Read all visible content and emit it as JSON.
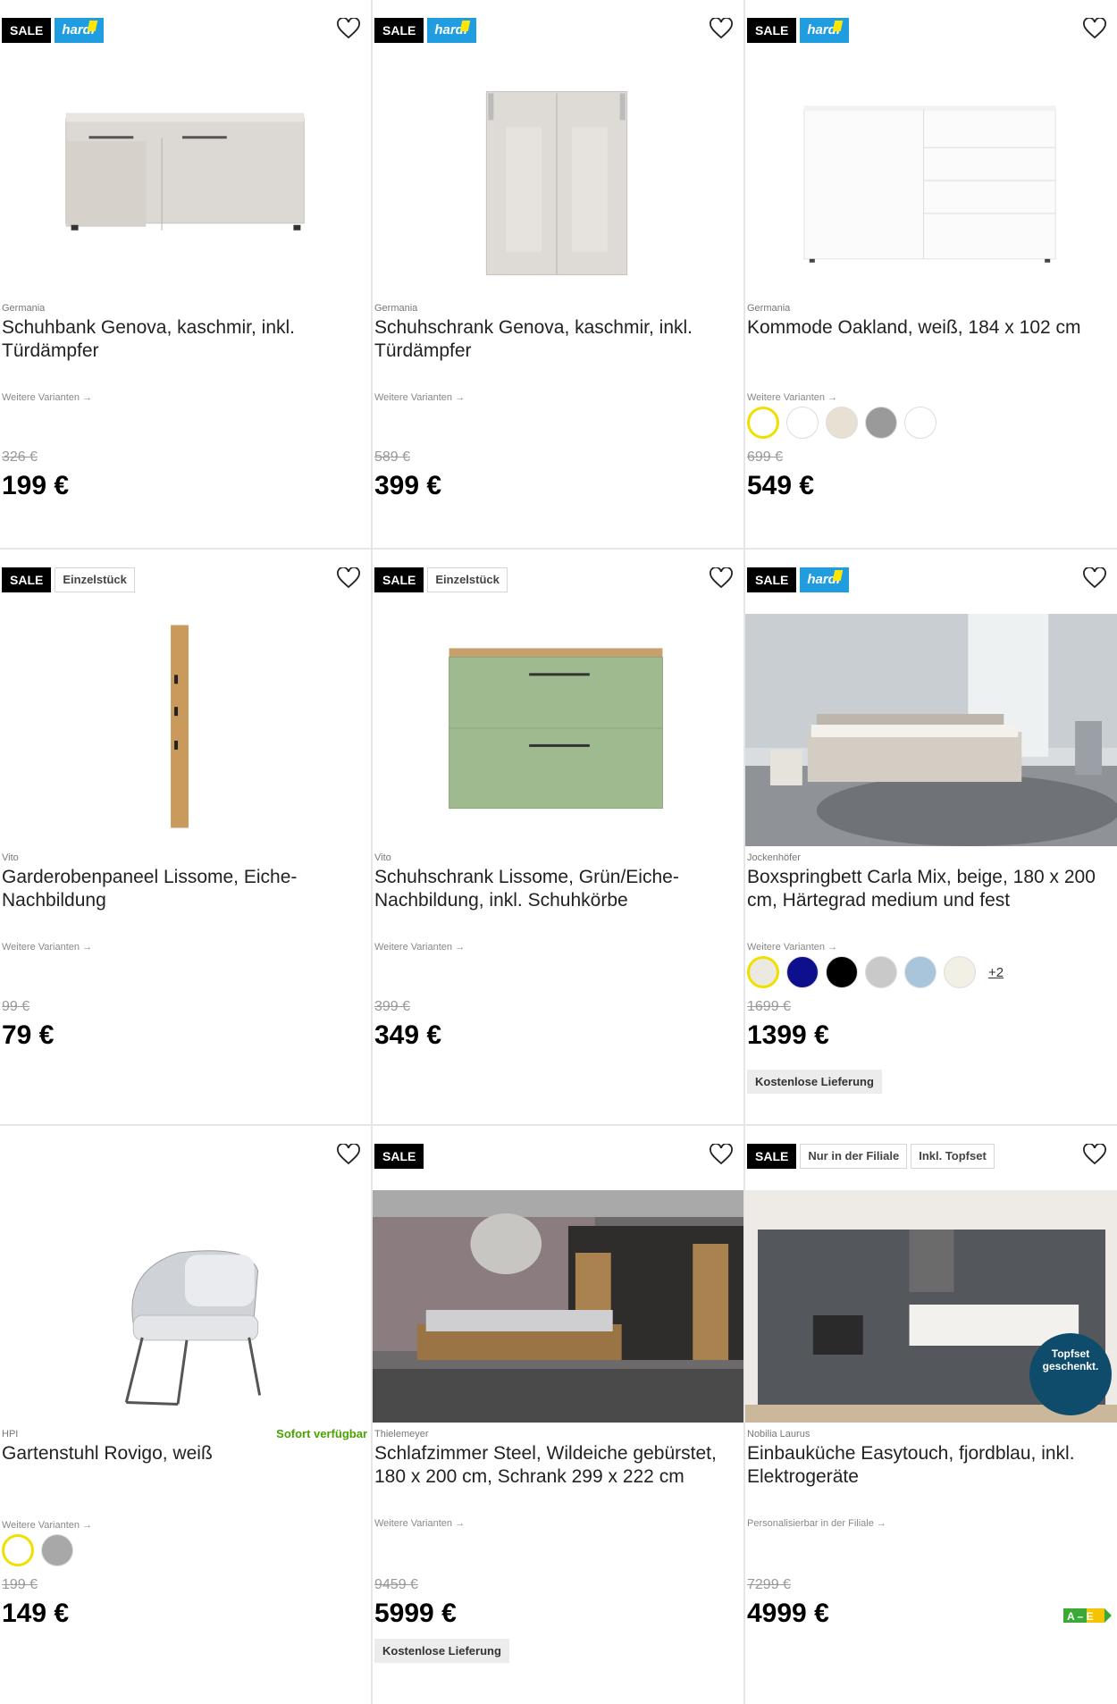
{
  "common": {
    "sale": "SALE",
    "hardi": "hardi",
    "variants_link": "Weitere Varianten →",
    "delivery": "Kostenlose Lieferung"
  },
  "products": [
    {
      "brand": "Germania",
      "title": "Schuhbank Genova, kaschmir, inkl. Türdämpfer",
      "old_price": "326 €",
      "price": "199 €",
      "tags": [],
      "variants": "Weitere Varianten →"
    },
    {
      "brand": "Germania",
      "title": "Schuhschrank Genova, kaschmir, inkl. Türdämpfer",
      "old_price": "589 €",
      "price": "399 €",
      "tags": [],
      "variants": "Weitere Varianten →"
    },
    {
      "brand": "Germania",
      "title": "Kommode Oakland, weiß, 184 x 102 cm",
      "old_price": "699 €",
      "price": "549 €",
      "tags": [],
      "variants": "Weitere Varianten →",
      "swatch_colors": [
        "#ffffff",
        "#ffffff",
        "#e8e0d2",
        "#9a9a9a",
        "#ffffff"
      ]
    },
    {
      "brand": "Vito",
      "title": "Garderobenpaneel Lissome, Eiche-Nachbildung",
      "old_price": "99 €",
      "price": "79 €",
      "tags": [
        "Einzelstück"
      ],
      "variants": "Weitere Varianten →"
    },
    {
      "brand": "Vito",
      "title": "Schuhschrank Lissome, Grün/Eiche-Nachbildung, inkl. Schuhkörbe",
      "old_price": "399 €",
      "price": "349 €",
      "tags": [
        "Einzelstück"
      ],
      "variants": "Weitere Varianten →"
    },
    {
      "brand": "Jockenhöfer",
      "title": "Boxspringbett Carla Mix, beige, 180 x 200 cm, Härtegrad medium und fest",
      "old_price": "1699 €",
      "price": "1399 €",
      "tags": [],
      "variants": "Weitere Varianten →",
      "swatch_colors": [
        "#ece9e0",
        "#0d0f8c",
        "#000000",
        "#c9c9c9",
        "#a9c5dc",
        "#f2efe4"
      ],
      "more": "+2",
      "delivery": "Kostenlose Lieferung"
    },
    {
      "brand": "HPI",
      "title": "Gartenstuhl Rovigo, weiß",
      "old_price": "199 €",
      "price": "149 €",
      "tags": [],
      "variants": "Weitere Varianten →",
      "availability": "Sofort verfügbar",
      "swatch_colors": [
        "#ffffff",
        "#a8a8a8"
      ]
    },
    {
      "brand": "Thielemeyer",
      "title": "Schlafzimmer Steel, Wildeiche gebürstet, 180 x 200 cm, Schrank 299 x 222 cm",
      "old_price": "9459 €",
      "price": "5999 €",
      "tags": [],
      "variants": "Weitere Varianten →",
      "delivery": "Kostenlose Lieferung"
    },
    {
      "brand": "Nobilia Laurus",
      "title": "Einbauküche Easytouch, fjordblau, inkl. Elektrogeräte",
      "old_price": "7299 €",
      "price": "4999 €",
      "tags": [
        "Nur in der Filiale",
        "Inkl. Topfset"
      ],
      "variants": "Personalisierbar in der Filiale →",
      "promo_line1": "Topfset",
      "promo_line2": "geschenkt.",
      "energy": "A – E"
    }
  ]
}
